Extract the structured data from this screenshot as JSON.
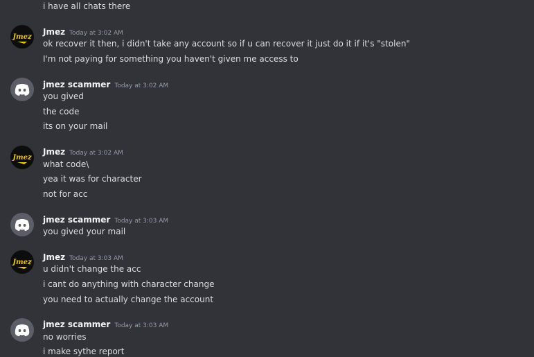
{
  "messages": [
    {
      "type": "cont",
      "text": "i have all chats there"
    },
    {
      "type": "group",
      "author": "Jmez",
      "time": "Today at 3:02 AM",
      "avatar": "jmez-logo-icon",
      "lines": [
        "ok recover it then, i didn't take any account so if u can recover it just do it if it's \"stolen\"",
        "I'm not paying for something you haven't given me access to"
      ]
    },
    {
      "type": "group",
      "author": "jmez scammer",
      "time": "Today at 3:02 AM",
      "avatar": "discord-logo-icon",
      "lines": [
        "you gived",
        "the code",
        "its on your mail"
      ]
    },
    {
      "type": "group",
      "author": "Jmez",
      "time": "Today at 3:02 AM",
      "avatar": "jmez-logo-icon",
      "lines": [
        "what code\\",
        "yea it was for character",
        "not for acc"
      ]
    },
    {
      "type": "group",
      "author": "jmez scammer",
      "time": "Today at 3:03 AM",
      "avatar": "discord-logo-icon",
      "lines": [
        "you gived your mail"
      ]
    },
    {
      "type": "group",
      "author": "Jmez",
      "time": "Today at 3:03 AM",
      "avatar": "jmez-logo-icon",
      "lines": [
        "u didn't change the acc",
        "i cant do anything with character change",
        "you need to actually change the account"
      ]
    },
    {
      "type": "group",
      "author": "jmez scammer",
      "time": "Today at 3:03 AM",
      "avatar": "discord-logo-icon",
      "lines": [
        "no worries",
        "i make sythe report"
      ]
    }
  ],
  "colors": {
    "background": "#313338",
    "author": "#f2f3f5",
    "text": "#dbdee1",
    "timestamp": "#949ba4"
  },
  "avatar_logo_text": "Jmez"
}
